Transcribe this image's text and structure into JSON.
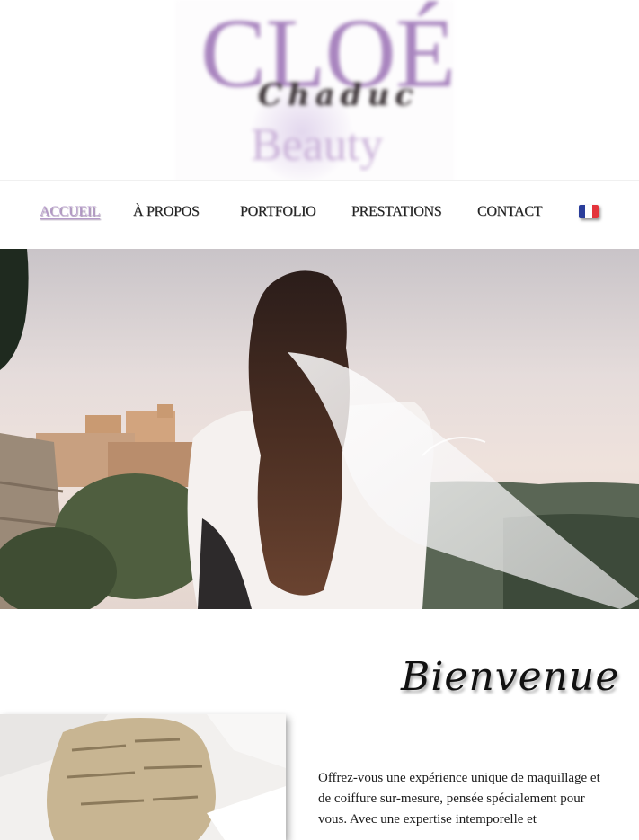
{
  "logo": {
    "main": "CLOÉ",
    "script": "Chaduc",
    "sub": "Beauty"
  },
  "nav": {
    "items": [
      {
        "label": "ACCUEIL",
        "active": true
      },
      {
        "label": "À PROPOS",
        "active": false
      },
      {
        "label": "PORTFOLIO",
        "active": false
      },
      {
        "label": "PRESTATIONS",
        "active": false
      },
      {
        "label": "CONTACT",
        "active": false
      }
    ],
    "language_flag": "flag-france-icon"
  },
  "welcome": {
    "title": "Bienvenue",
    "intro": "Offrez-vous une expérience unique de maquillage et de coiffure sur-mesure, pensée spécialement pour vous. Avec une expertise intemporelle et"
  },
  "colors": {
    "accent": "#b59ac9",
    "logo": "#a985bf",
    "text": "#1c1c1c",
    "flag_blue": "#2a3d9a",
    "flag_white": "#ffffff",
    "flag_red": "#e4343c"
  }
}
